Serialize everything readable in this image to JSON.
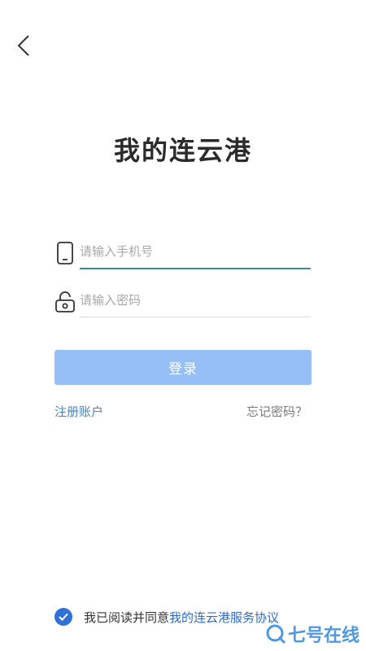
{
  "header": {
    "back_icon": "chevron-left-icon"
  },
  "app_title": "我的连云港",
  "phone_input": {
    "icon": "mobile-phone-icon",
    "placeholder": "请输入手机号",
    "value": ""
  },
  "password_input": {
    "icon": "lock-icon",
    "placeholder": "请输入密码",
    "value": ""
  },
  "login_button": {
    "label": "登录",
    "color": "#96bff7"
  },
  "links": {
    "register": "注册账户",
    "forgot_password": "忘记密码？"
  },
  "agreement": {
    "checked": true,
    "text": "我已阅读并同意",
    "link": "我的连云港服务协议"
  },
  "watermark": {
    "text": "七号在线"
  },
  "colors": {
    "accent": "#2f71d6",
    "link": "#4d82b8",
    "input_focus_line": "#3a8f86"
  }
}
